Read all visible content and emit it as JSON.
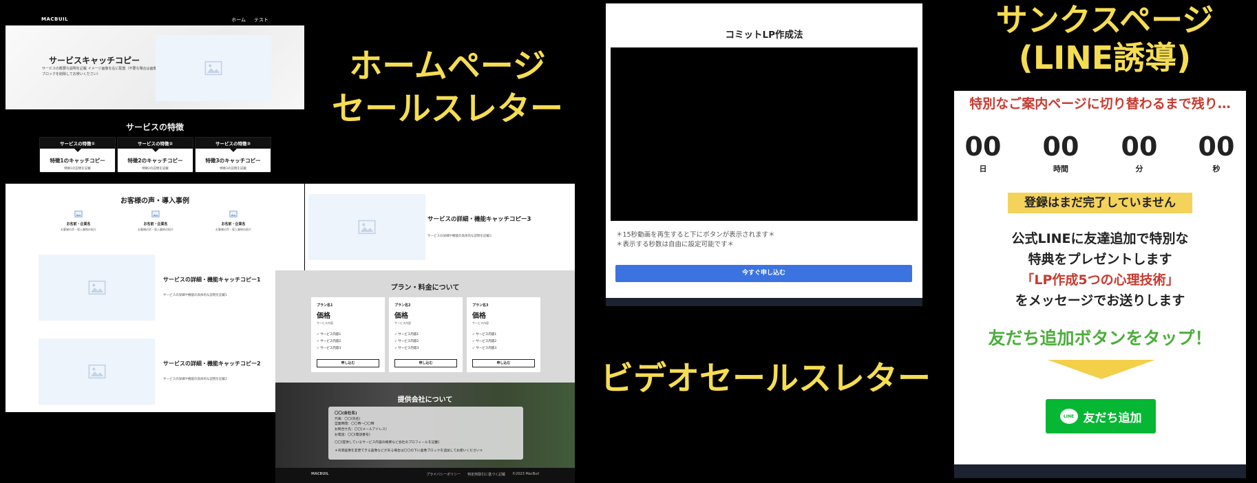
{
  "labels": {
    "home": [
      "ホームページ",
      "セールスレター"
    ],
    "video": "ビデオセールスレター",
    "thanks": [
      "サンクスページ",
      "(LINE誘導)"
    ]
  },
  "home": {
    "logo": "MACBUIL",
    "nav": [
      "ホーム",
      "テスト"
    ],
    "hero_title": "サービスキャッチコピー",
    "hero_desc": "サービスの概要な説明を記載 イメージ画像を右に配置（不要な場合は画像ブロックを削除してお使いください）",
    "features_title": "サービスの特徴",
    "features": [
      {
        "head": "サービスの特徴①",
        "title": "特徴1のキャッチコピー",
        "desc": "特徴1の説明を記載"
      },
      {
        "head": "サービスの特徴②",
        "title": "特徴2のキャッチコピー",
        "desc": "特徴2の説明を記載"
      },
      {
        "head": "サービスの特徴③",
        "title": "特徴3のキャッチコピー",
        "desc": "特徴3の説明を記載"
      }
    ],
    "voice_title": "お客様の声・導入事例",
    "voices": [
      {
        "name": "お名前・企業名",
        "desc": "お客様の声・導入事例の紹介"
      },
      {
        "name": "お名前・企業名",
        "desc": "お客様の声・導入事例の紹介"
      },
      {
        "name": "お名前・企業名",
        "desc": "お客様の声・導入事例の紹介"
      }
    ],
    "details": [
      {
        "title": "サービスの詳細・機能キャッチコピー1",
        "desc": "サービスの詳細や機能の具体的な説明を記載1"
      },
      {
        "title": "サービスの詳細・機能キャッチコピー2",
        "desc": "サービスの詳細や機能の具体的な説明を記載2"
      },
      {
        "title": "サービスの詳細・機能キャッチコピー3",
        "desc": "サービスの詳細や機能の具体的な説明を記載3"
      }
    ]
  },
  "pricing": {
    "title": "プラン・料金について",
    "plans": [
      {
        "name": "プラン名1",
        "price": "価格",
        "unit": "サービス内容",
        "items": [
          "サービス内容1",
          "サービス内容2",
          "サービス内容3"
        ],
        "button": "申し込む"
      },
      {
        "name": "プラン名2",
        "price": "価格",
        "unit": "サービス内容",
        "items": [
          "サービス内容1",
          "サービス内容2",
          "サービス内容3"
        ],
        "button": "申し込む"
      },
      {
        "name": "プラン名3",
        "price": "価格",
        "unit": "サービス内容",
        "items": [
          "サービス内容1",
          "サービス内容2",
          "サービス内容3"
        ],
        "button": "申し込む"
      }
    ]
  },
  "company": {
    "title": "提供会社について",
    "name": "〇〇(会社名)",
    "lines": [
      "代表：〇〇(氏名)",
      "営業時間：〇〇時〜〇〇時",
      "お問合せ先：〇〇(メールアドレス)",
      "お電話：〇〇(電話番号)"
    ],
    "note1": "〇〇(提供しているサービス内容の概要など会社のプロフィールを記載)",
    "note2": "＊背景画像を変更できる画像などがある場合は〇〇の下に画像ブロックを追加してお使いください＊"
  },
  "footer": {
    "logo": "MACBUIL",
    "links": [
      "プライバシーポリシー",
      "特定商取引に基づく記載",
      "©2023 MacBuil"
    ]
  },
  "video": {
    "title": "コミットLP作成法",
    "note1": "＊15秒動画を再生すると下にボタンが表示されます＊",
    "note2": "＊表示する秒数は自由に設定可能です＊",
    "cta": "今すぐ申し込む"
  },
  "thanks": {
    "head": "特別なご案内ページに切り替わるまで残り…",
    "countdown": [
      {
        "value": "00",
        "unit": "日"
      },
      {
        "value": "00",
        "unit": "時間"
      },
      {
        "value": "00",
        "unit": "分"
      },
      {
        "value": "00",
        "unit": "秒"
      }
    ],
    "warning": "登録はまだ完了していません",
    "msg1": "公式LINEに友達追加で特別な",
    "msg2": "特典をプレゼントします",
    "msg3": "「LP作成5つの心理技術」",
    "msg4": "をメッセージでお送りします",
    "tap": "友だち追加ボタンをタップ！",
    "line_icon": "LINE",
    "line_button": "友だち追加"
  },
  "colors": {
    "label_yellow": "#f5dd52",
    "cta_blue": "#3b73e1",
    "line_green": "#06b733",
    "accent_red": "#c83a2f",
    "tap_green": "#4bae3a"
  }
}
